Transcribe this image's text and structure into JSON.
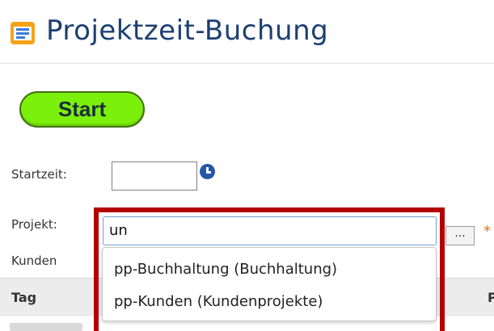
{
  "header": {
    "title": "Projektzeit-Buchung",
    "icon": "form-list-icon"
  },
  "actions": {
    "start_label": "Start",
    "accent_color": "#7bf00a"
  },
  "form": {
    "start_time_label": "Startzeit:",
    "start_time_value": "",
    "clock_icon": "clock-icon",
    "project_label": "Projekt:",
    "project_value": "un",
    "browse_label": "...",
    "required_marker": "*",
    "customer_label": "Kunden"
  },
  "autocomplete": {
    "options": [
      "pp-Buchhaltung (Buchhaltung)",
      "pp-Kunden (Kundenprojekte)"
    ]
  },
  "table": {
    "headers": [
      "Tag",
      "P"
    ]
  },
  "annotation": {
    "highlight_color": "#b40000"
  }
}
